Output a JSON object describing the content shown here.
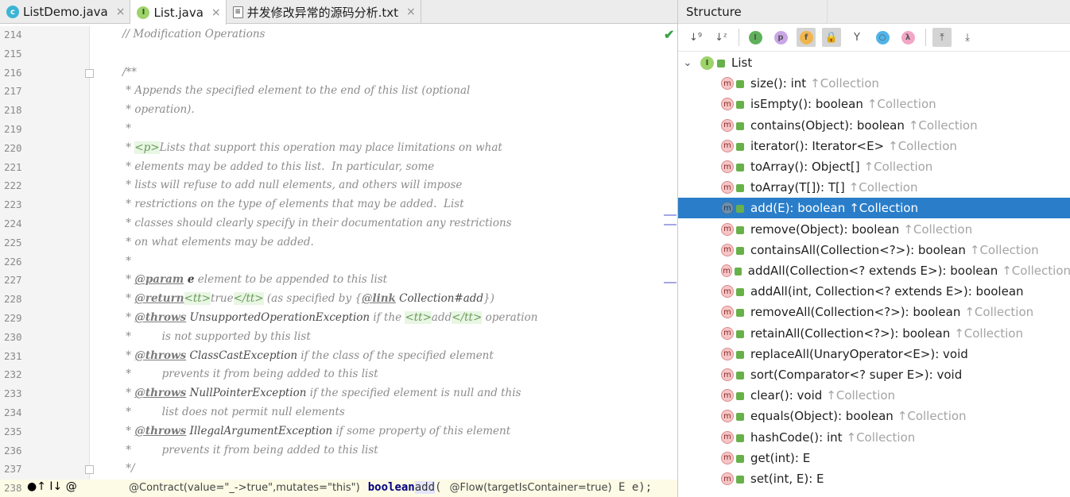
{
  "tabs": [
    {
      "label": "ListDemo.java",
      "icon": "class-icon",
      "active": false
    },
    {
      "label": "List.java",
      "icon": "interface-icon",
      "active": true
    },
    {
      "label": "并发修改异常的源码分析.txt",
      "icon": "text-file-icon",
      "active": false
    }
  ],
  "tab_close_glyph": "×",
  "editor": {
    "lines": [
      {
        "n": "214",
        "text": "// Modification Operations"
      },
      {
        "n": "215",
        "text": ""
      },
      {
        "n": "216",
        "text": "/**"
      },
      {
        "n": "217",
        "text": " * Appends the specified element to the end of this list (optional"
      },
      {
        "n": "218",
        "text": " * operation)."
      },
      {
        "n": "219",
        "text": " *"
      },
      {
        "n": "220",
        "pre": " * ",
        "tag": "<p>",
        "post": "Lists that support this operation may place limitations on what"
      },
      {
        "n": "221",
        "text": " * elements may be added to this list.  In particular, some"
      },
      {
        "n": "222",
        "text": " * lists will refuse to add null elements, and others will impose"
      },
      {
        "n": "223",
        "text": " * restrictions on the type of elements that may be added.  List"
      },
      {
        "n": "224",
        "text": " * classes should clearly specify in their documentation any restrictions"
      },
      {
        "n": "225",
        "text": " * on what elements may be added."
      },
      {
        "n": "226",
        "text": " *"
      },
      {
        "n": "227",
        "pre": " * ",
        "kw": "@param",
        "name": " e",
        "post": " element to be appended to this list"
      },
      {
        "n": "228",
        "pre": " * ",
        "kw": "@return",
        "tag1": "<tt>",
        "mid": "true",
        "tag2": "</tt>",
        "post": " (as specified by {",
        "kw2": "@link",
        "ref": " Collection#add",
        "end": "})"
      },
      {
        "n": "229",
        "pre": " * ",
        "kw": "@throws",
        "ref": " UnsupportedOperationException",
        "post": " if the ",
        "tag1": "<tt>",
        "mid": "add",
        "tag2": "</tt>",
        "end": " operation"
      },
      {
        "n": "230",
        "text": " *         is not supported by this list"
      },
      {
        "n": "231",
        "pre": " * ",
        "kw": "@throws",
        "ref": " ClassCastException",
        "post": " if the class of the specified element"
      },
      {
        "n": "232",
        "text": " *         prevents it from being added to this list"
      },
      {
        "n": "233",
        "pre": " * ",
        "kw": "@throws",
        "ref": " NullPointerException",
        "post": " if the specified element is null and this"
      },
      {
        "n": "234",
        "text": " *         list does not permit null elements"
      },
      {
        "n": "235",
        "pre": " * ",
        "kw": "@throws",
        "ref": " IllegalArgumentException",
        "post": " if some property of this element"
      },
      {
        "n": "236",
        "text": " *         prevents it from being added to this list"
      },
      {
        "n": "237",
        "text": " */"
      }
    ],
    "last_line": {
      "n": "238",
      "contract": "@Contract(value=\"_->true\",mutates=\"this\")",
      "type": "boolean",
      "method": "add",
      "open": "(",
      "flow": "@Flow(targetIsContainer=true)",
      "param": " E e);"
    },
    "gutter_icons": "●↑ I↓ @"
  },
  "structure": {
    "title": "Structure",
    "root": {
      "label": "List",
      "expanded_glyph": "⌄"
    },
    "items": [
      {
        "label": "size(): int",
        "inherited": "↑Collection"
      },
      {
        "label": "isEmpty(): boolean",
        "inherited": "↑Collection"
      },
      {
        "label": "contains(Object): boolean",
        "inherited": "↑Collection"
      },
      {
        "label": "iterator(): Iterator<E>",
        "inherited": "↑Collection"
      },
      {
        "label": "toArray(): Object[]",
        "inherited": "↑Collection"
      },
      {
        "label": "toArray(T[]): T[]",
        "inherited": "↑Collection"
      },
      {
        "label": "add(E): boolean",
        "inherited": "↑Collection",
        "selected": true
      },
      {
        "label": "remove(Object): boolean",
        "inherited": "↑Collection"
      },
      {
        "label": "containsAll(Collection<?>): boolean",
        "inherited": "↑Collection"
      },
      {
        "label": "addAll(Collection<? extends E>): boolean",
        "inherited": "↑Collection"
      },
      {
        "label": "addAll(int, Collection<? extends E>): boolean",
        "inherited": ""
      },
      {
        "label": "removeAll(Collection<?>): boolean",
        "inherited": "↑Collection"
      },
      {
        "label": "retainAll(Collection<?>): boolean",
        "inherited": "↑Collection"
      },
      {
        "label": "replaceAll(UnaryOperator<E>): void",
        "inherited": ""
      },
      {
        "label": "sort(Comparator<? super E>): void",
        "inherited": ""
      },
      {
        "label": "clear(): void",
        "inherited": "↑Collection"
      },
      {
        "label": "equals(Object): boolean",
        "inherited": "↑Collection"
      },
      {
        "label": "hashCode(): int",
        "inherited": "↑Collection"
      },
      {
        "label": "get(int): E",
        "inherited": ""
      },
      {
        "label": "set(int, E): E",
        "inherited": ""
      }
    ],
    "toolbar": [
      {
        "name": "sort-by-visibility-icon",
        "glyph": "↓⁹",
        "on": false
      },
      {
        "name": "sort-alphabetically-icon",
        "glyph": "↓ᶻ",
        "on": false
      },
      {
        "name": "show-inherited-icon",
        "glyph": "I",
        "on": false,
        "dot": "#5fb05a"
      },
      {
        "name": "show-properties-icon",
        "glyph": "p",
        "on": false,
        "dot": "#c9a6e6"
      },
      {
        "name": "show-fields-icon",
        "glyph": "f",
        "on": true,
        "dot": "#f0b54c"
      },
      {
        "name": "show-non-public-icon",
        "glyph": "🔒",
        "on": true
      },
      {
        "name": "show-anonymous-icon",
        "glyph": "Y",
        "on": false
      },
      {
        "name": "show-lambdas-icon",
        "glyph": "○",
        "on": false,
        "dot": "#4fb4e8"
      },
      {
        "name": "show-lambda-icon",
        "glyph": "λ",
        "on": false,
        "dot": "#f2a6c6"
      },
      {
        "name": "autoscroll-to-source-icon",
        "glyph": "⤒",
        "on": true
      },
      {
        "name": "autoscroll-from-source-icon",
        "glyph": "⤓",
        "on": false
      }
    ],
    "method_icon_letter": "m"
  },
  "colors": {
    "selection": "#2a7ec9",
    "interface_green": "#9ed26b"
  }
}
